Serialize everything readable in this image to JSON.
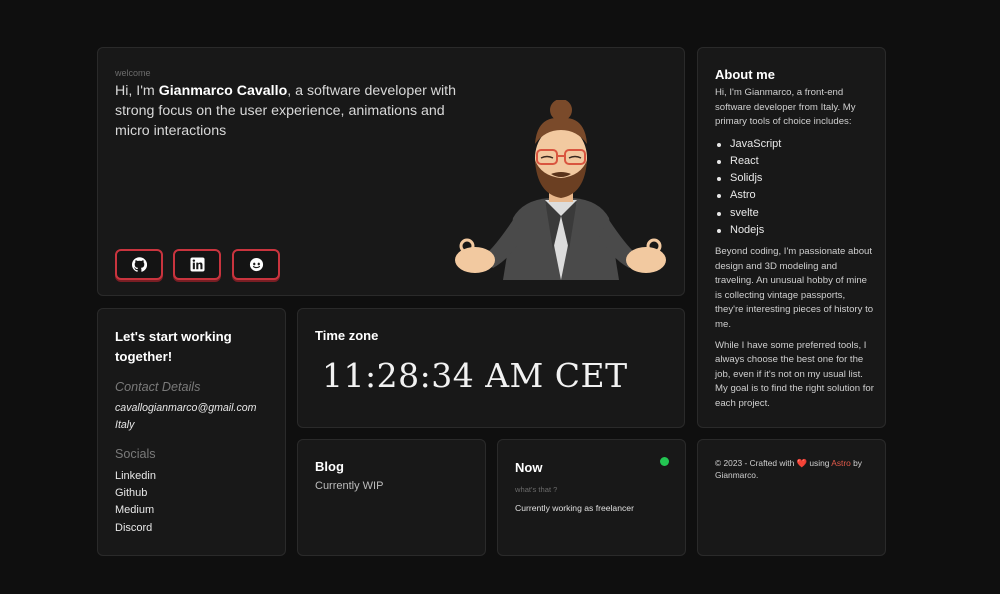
{
  "hero": {
    "welcome": "welcome",
    "intro_prefix": "Hi, I'm ",
    "name": "Gianmarco Cavallo",
    "intro_suffix": ", a software developer with strong focus on the user experience, animations and micro interactions",
    "socials": [
      {
        "icon": "github-icon"
      },
      {
        "icon": "linkedin-icon"
      },
      {
        "icon": "discord-icon"
      }
    ],
    "accent_color": "#c9343e"
  },
  "about": {
    "title": "About me",
    "intro": "Hi, I'm Gianmarco, a front-end software developer from Italy. My primary tools of choice includes:",
    "tools": [
      "JavaScript",
      "React",
      "Solidjs",
      "Astro",
      "svelte",
      "Nodejs"
    ],
    "p1": "Beyond coding, I'm passionate about design and 3D modeling and traveling. An unusual hobby of mine is collecting vintage passports, they're interesting pieces of history to me.",
    "p2": "While I have some preferred tools, I always choose the best one for the job, even if it's not on my usual list. My goal is to find the right solution for each project."
  },
  "contact": {
    "title": "Let's start working together!",
    "details_heading": "Contact Details",
    "email": "cavallogianmarco@gmail.com",
    "location": "Italy",
    "socials_heading": "Socials",
    "socials": [
      "Linkedin",
      "Github",
      "Medium",
      "Discord"
    ]
  },
  "timezone": {
    "title": "Time zone",
    "time": "11:28:34 AM CET"
  },
  "blog": {
    "title": "Blog",
    "status": "Currently WIP"
  },
  "now": {
    "title": "Now",
    "question": "what's that ?",
    "status": "Currently working as freelancer",
    "indicator_color": "#23c552"
  },
  "footer": {
    "prefix": "© 2023 - Crafted with ",
    "heart": "❤️",
    "middle": " using ",
    "astro": "Astro",
    "suffix": " by Gianmarco."
  }
}
